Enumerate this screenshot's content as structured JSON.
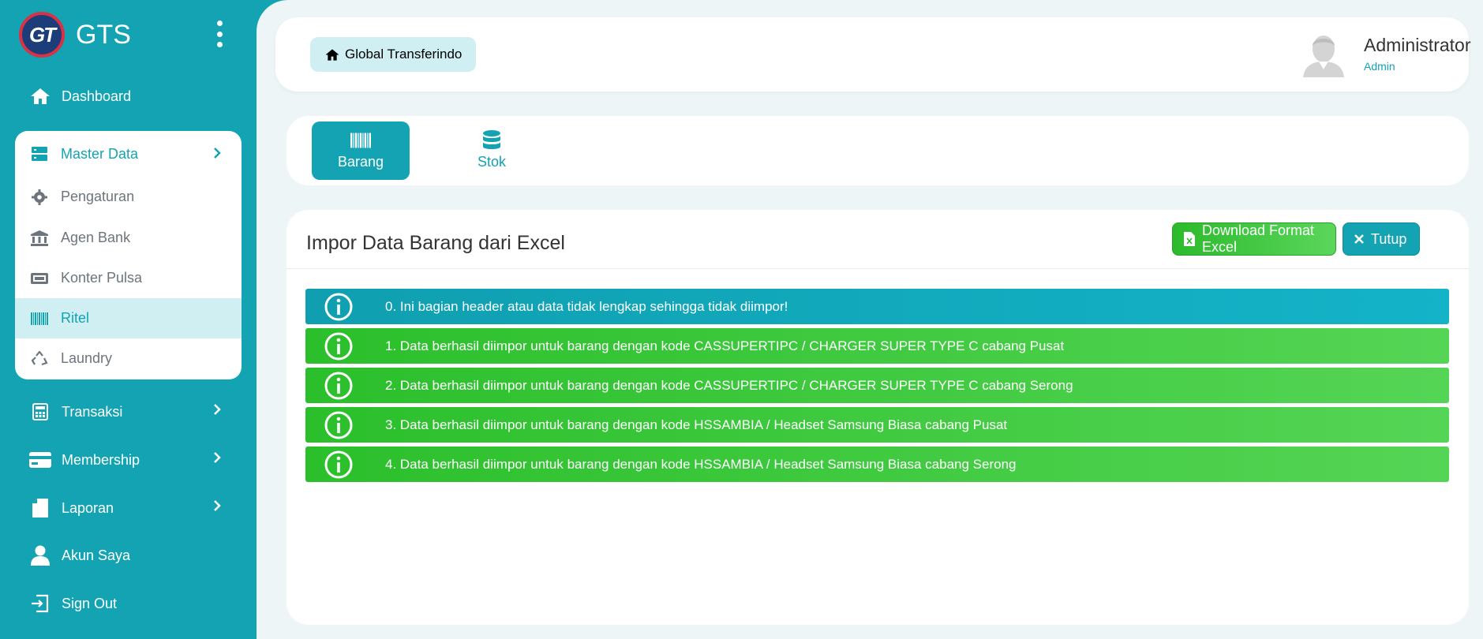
{
  "brand": {
    "logo_text": "GT",
    "name": "GTS"
  },
  "sidebar": {
    "dashboard": "Dashboard",
    "master_data": {
      "label": "Master Data",
      "items": [
        {
          "label": "Pengaturan",
          "icon": "gear-icon"
        },
        {
          "label": "Agen Bank",
          "icon": "bank-icon"
        },
        {
          "label": "Konter Pulsa",
          "icon": "pulsa-icon"
        },
        {
          "label": "Ritel",
          "icon": "barcode-icon",
          "active": true
        },
        {
          "label": "Laundry",
          "icon": "recycle-icon"
        }
      ]
    },
    "transaksi": "Transaksi",
    "membership": "Membership",
    "laporan": "Laporan",
    "akun_saya": "Akun Saya",
    "sign_out": "Sign Out"
  },
  "header": {
    "breadcrumb": "Global Transferindo",
    "user": {
      "name": "Administrator",
      "role": "Admin"
    }
  },
  "tabs": [
    {
      "label": "Barang",
      "active": true,
      "icon": "barcode-icon"
    },
    {
      "label": "Stok",
      "active": false,
      "icon": "database-icon"
    }
  ],
  "card": {
    "title": "Impor Data Barang dari Excel",
    "download_button": "Download Format Excel",
    "close_button": "Tutup"
  },
  "alerts": [
    {
      "type": "info",
      "text": "0. Ini bagian header atau data tidak lengkap sehingga tidak diimpor!"
    },
    {
      "type": "success",
      "text": "1. Data berhasil diimpor untuk barang dengan kode CASSUPERTIPC / CHARGER SUPER TYPE C cabang Pusat"
    },
    {
      "type": "success",
      "text": "2. Data berhasil diimpor untuk barang dengan kode CASSUPERTIPC / CHARGER SUPER TYPE C cabang Serong"
    },
    {
      "type": "success",
      "text": "3. Data berhasil diimpor untuk barang dengan kode HSSAMBIA / Headset Samsung Biasa cabang Pusat"
    },
    {
      "type": "success",
      "text": "4. Data berhasil diimpor untuk barang dengan kode HSSAMBIA / Headset Samsung Biasa cabang Serong"
    }
  ],
  "colors": {
    "primary": "#13a3b3",
    "success": "#2bbf2b",
    "background": "#eef5f7",
    "active_submenu": "#cfeff2"
  }
}
